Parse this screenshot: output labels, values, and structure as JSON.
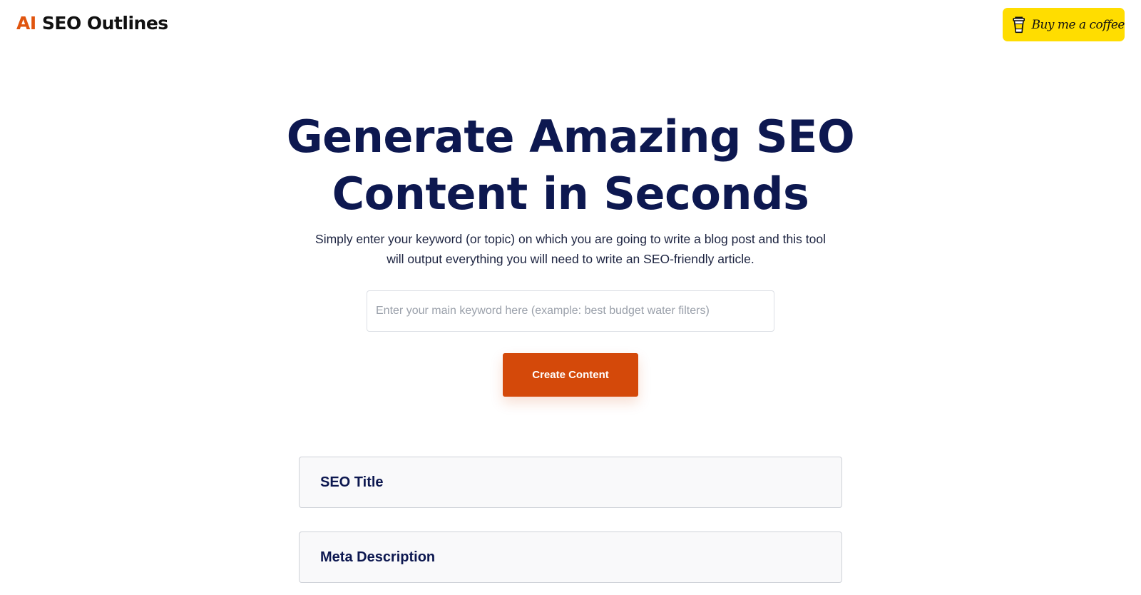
{
  "header": {
    "logo_accent": "AI",
    "logo_text": "SEO Outlines",
    "coffee_label": "Buy me a coffee",
    "coffee_icon": "coffee-cup-icon"
  },
  "hero": {
    "title_line1": "Generate Amazing SEO",
    "title_line2": "Content in Seconds",
    "subtitle_line1": "Simply enter your keyword (or topic) on which you are going to write a blog post and this tool",
    "subtitle_line2": "will output everything you will need to write an SEO-friendly article."
  },
  "form": {
    "keyword_value": "",
    "keyword_placeholder": "Enter your main keyword here (example: best budget water filters)",
    "submit_label": "Create Content"
  },
  "results": [
    {
      "title": "SEO Title"
    },
    {
      "title": "Meta Description"
    }
  ],
  "colors": {
    "brand_accent": "#e0550f",
    "button": "#d4490a",
    "heading": "#0d1850",
    "coffee_yellow": "#ffdd00"
  }
}
